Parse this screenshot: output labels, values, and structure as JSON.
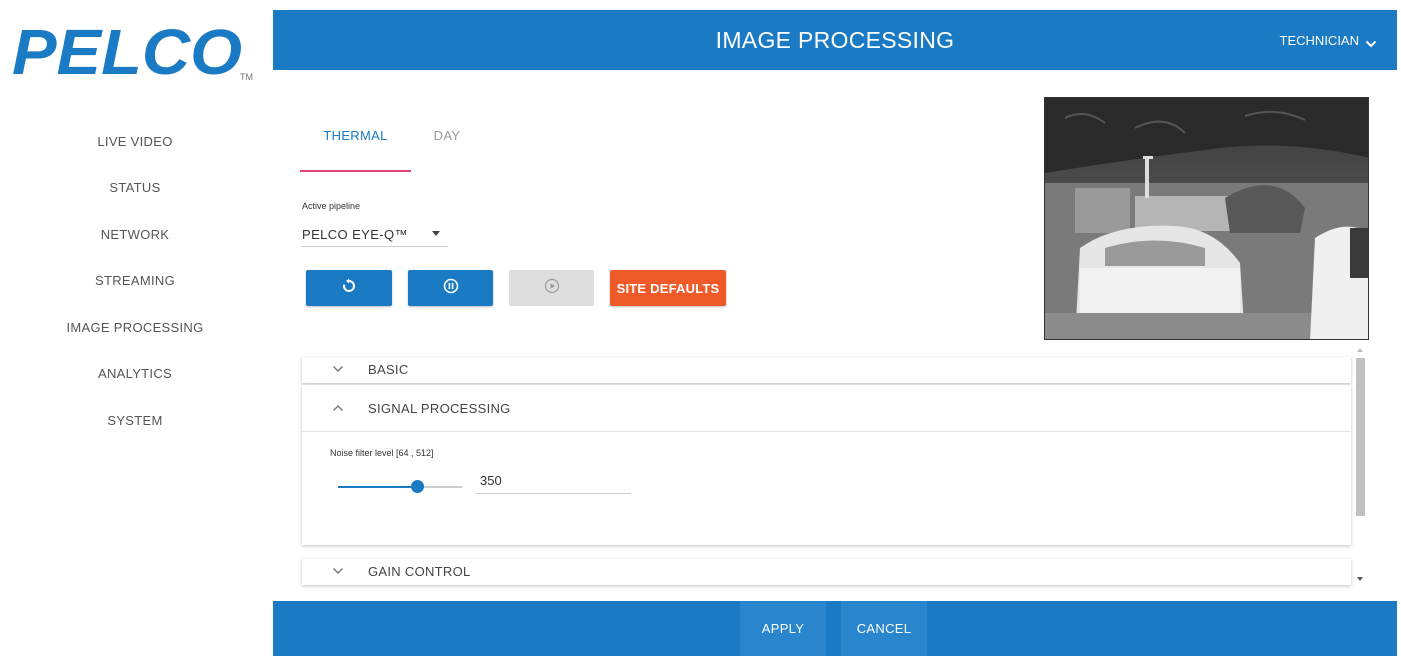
{
  "brand": {
    "logo_text": "PELCO",
    "trademark": "TM",
    "color": "#1a7ac3"
  },
  "sidebar": {
    "items": [
      {
        "label": "LIVE VIDEO"
      },
      {
        "label": "STATUS"
      },
      {
        "label": "NETWORK"
      },
      {
        "label": "STREAMING"
      },
      {
        "label": "IMAGE PROCESSING"
      },
      {
        "label": "ANALYTICS"
      },
      {
        "label": "SYSTEM"
      }
    ]
  },
  "header": {
    "title": "IMAGE PROCESSING",
    "user": "TECHNICIAN",
    "user_icon": "chevron-down-icon"
  },
  "tabs": [
    {
      "label": "THERMAL",
      "active": true
    },
    {
      "label": "DAY",
      "active": false
    }
  ],
  "pipeline": {
    "label": "Active pipeline",
    "value": "PELCO EYE-Q™"
  },
  "actions": {
    "reset_icon": "reset-icon",
    "pause_icon": "pause-icon",
    "play_icon": "play-icon",
    "site_defaults_label": "SITE DEFAULTS"
  },
  "sections": {
    "basic": {
      "label": "BASIC",
      "expanded": false
    },
    "signal_processing": {
      "label": "SIGNAL PROCESSING",
      "expanded": true,
      "noise_filter": {
        "label": "Noise filter level [64 , 512]",
        "value": "350",
        "min": 64,
        "max": 512
      }
    },
    "gain_control": {
      "label": "GAIN CONTROL",
      "expanded": false
    }
  },
  "footer": {
    "apply_label": "APPLY",
    "cancel_label": "CANCEL"
  },
  "colors": {
    "primary": "#1a7ac3",
    "accent_orange": "#f05a28",
    "tab_underline": "#e0457b",
    "disabled": "#dedede"
  }
}
